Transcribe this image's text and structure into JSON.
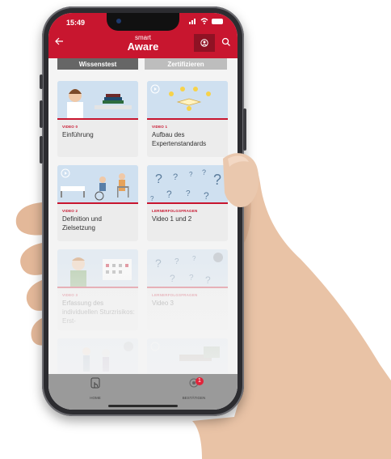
{
  "status": {
    "time": "15:49"
  },
  "header": {
    "brand_small": "smart",
    "brand_big": "Aware"
  },
  "tabs": [
    {
      "label": "Wissenstest"
    },
    {
      "label": "Zertifizieren"
    }
  ],
  "cards": [
    {
      "category": "VIDEO 0",
      "title": "Einführung"
    },
    {
      "category": "VIDEO 1",
      "title": "Aufbau des Expertenstandards"
    },
    {
      "category": "VIDEO 2",
      "title": "Definition und Zielsetzung"
    },
    {
      "category": "LERNERFOLGSFRAGEN",
      "title": "Video 1 und 2"
    },
    {
      "category": "VIDEO 3",
      "title": "Erfassung des individuellen Sturzrisikos: Erst-"
    },
    {
      "category": "LERNERFOLGSFRAGEN",
      "title": "Video 3"
    }
  ],
  "bottom_nav": {
    "home_label": "HOME",
    "second_label": "BESTÄTIGEN",
    "badge": "1"
  },
  "colors": {
    "brand_red": "#c8162f",
    "dark_red": "#8f1224",
    "nav_gray": "#9a9a9a"
  }
}
